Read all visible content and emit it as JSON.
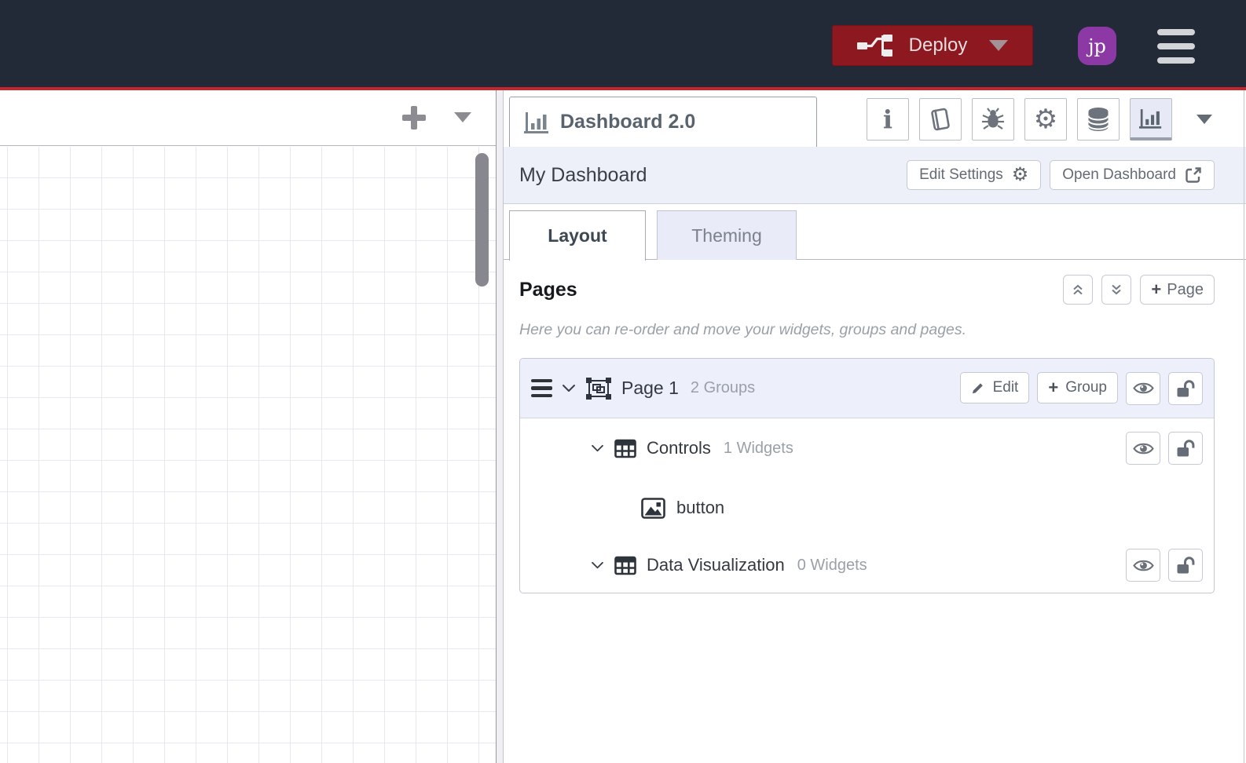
{
  "header": {
    "deploy": {
      "label": "Deploy"
    },
    "avatar": {
      "initials": "jp"
    }
  },
  "glyphs": {
    "plus": "+",
    "gear": "⚙",
    "info": "i"
  },
  "colors": {
    "header_bg": "#222937",
    "accent_line_red": "#c5262c",
    "deploy_red": "#8e1820",
    "avatar_purple": "#8c39a5",
    "active_panel_tab_bg": "#e7eaf6",
    "band_bg": "#eef0f9",
    "grid_line": "#e7e7f2"
  },
  "sidebar": {
    "tab_title": "Dashboard 2.0",
    "dashboard": {
      "name": "My Dashboard",
      "edit_settings_label": "Edit Settings",
      "open_dashboard_label": "Open Dashboard"
    },
    "tabs": {
      "layout": "Layout",
      "theming": "Theming"
    },
    "pages": {
      "title": "Pages",
      "add_page_label": "Page",
      "hint": "Here you can re-order and move your widgets, groups and pages.",
      "page": {
        "name": "Page 1",
        "meta": "2 Groups",
        "edit_label": "Edit",
        "add_group_label": "Group",
        "groups": [
          {
            "name": "Controls",
            "meta": "1 Widgets",
            "widgets": [
              {
                "name": "button"
              }
            ]
          },
          {
            "name": "Data Visualization",
            "meta": "0 Widgets",
            "widgets": []
          }
        ]
      }
    }
  }
}
